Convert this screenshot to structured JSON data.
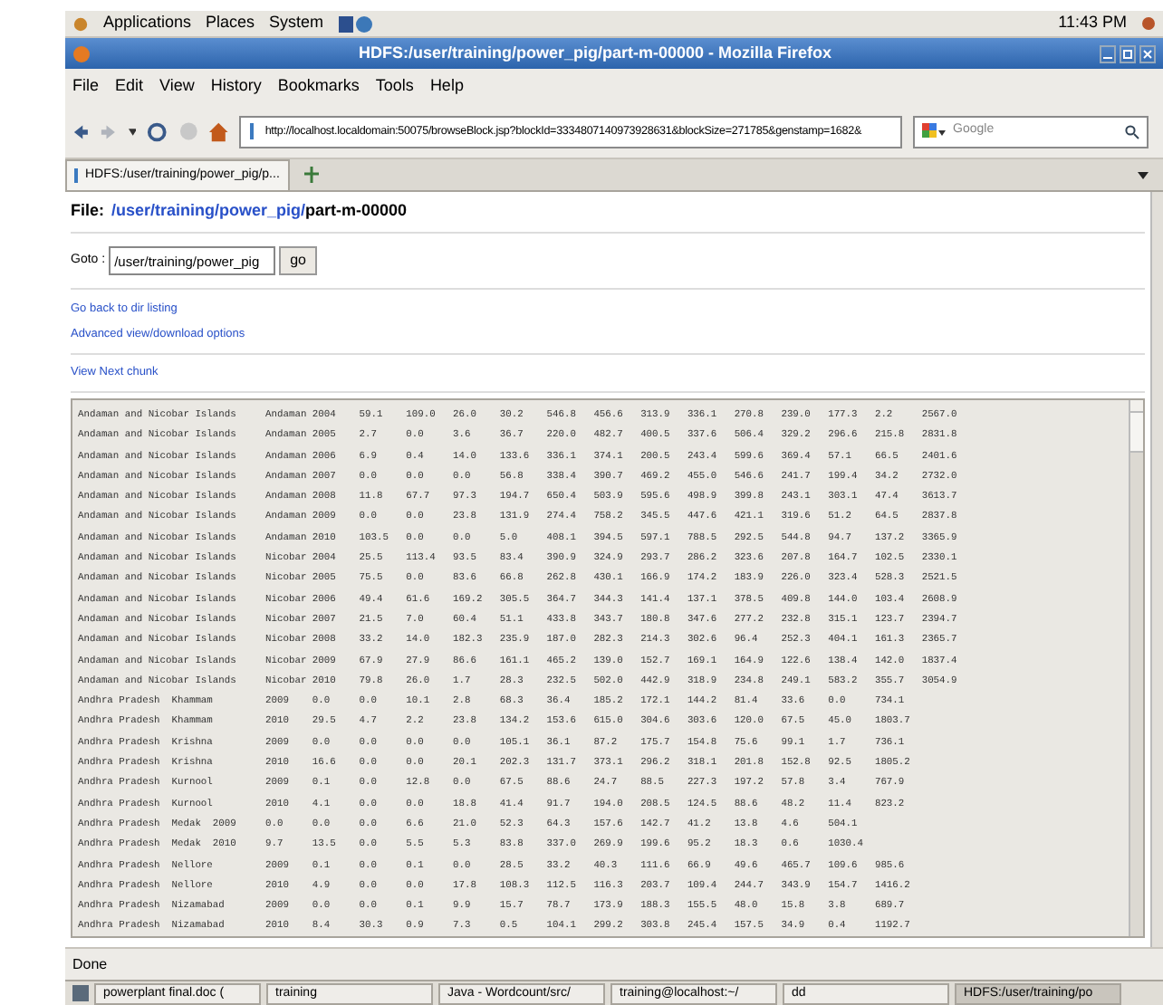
{
  "top_panel": {
    "menus": [
      "Applications",
      "Places",
      "System"
    ],
    "clock": "11:43 PM"
  },
  "window": {
    "title": "HDFS:/user/training/power_pig/part-m-00000 - Mozilla Firefox"
  },
  "menu": [
    "File",
    "Edit",
    "View",
    "History",
    "Bookmarks",
    "Tools",
    "Help"
  ],
  "nav": {
    "url": "http://localhost.localdomain:50075/browseBlock.jsp?blockId=3334807140973928631&blockSize=271785&genstamp=1682&",
    "search_placeholder": "Google"
  },
  "tabs": [
    {
      "label": "HDFS:/user/training/power_pig/p...",
      "selected": true
    }
  ],
  "page": {
    "file_label": "File:",
    "path_link": "/user/training/power_pig/",
    "file_name": "part-m-00000",
    "goto_label": "Goto :",
    "goto_value": "/user/training/power_pig",
    "go_button": "go",
    "links": [
      "Go back to dir listing",
      "Advanced view/download options"
    ],
    "next_link": "View Next chunk",
    "lines": [
      "Andaman and Nicobar Islands\tAndaman 2004\t59.1\t109.0\t26.0\t30.2\t546.8\t456.6\t313.9\t336.1\t270.8\t239.0\t177.3\t2.2\t2567.0",
      "Andaman and Nicobar Islands\tAndaman 2005\t2.7\t0.0\t3.6\t36.7\t220.0\t482.7\t400.5\t337.6\t506.4\t329.2\t296.6\t215.8\t2831.8",
      "Andaman and Nicobar Islands\tAndaman 2006\t6.9\t0.4\t14.0\t133.6\t336.1\t374.1\t200.5\t243.4\t599.6\t369.4\t57.1\t66.5\t2401.6",
      "Andaman and Nicobar Islands\tAndaman 2007\t0.0\t0.0\t0.0\t56.8\t338.4\t390.7\t469.2\t455.0\t546.6\t241.7\t199.4\t34.2\t2732.0",
      "Andaman and Nicobar Islands\tAndaman 2008\t11.8\t67.7\t97.3\t194.7\t650.4\t503.9\t595.6\t498.9\t399.8\t243.1\t303.1\t47.4\t3613.7",
      "Andaman and Nicobar Islands\tAndaman 2009\t0.0\t0.0\t23.8\t131.9\t274.4\t758.2\t345.5\t447.6\t421.1\t319.6\t51.2\t64.5\t2837.8",
      "Andaman and Nicobar Islands\tAndaman 2010\t103.5\t0.0\t0.0\t5.0\t408.1\t394.5\t597.1\t788.5\t292.5\t544.8\t94.7\t137.2\t3365.9",
      "Andaman and Nicobar Islands\tNicobar 2004\t25.5\t113.4\t93.5\t83.4\t390.9\t324.9\t293.7\t286.2\t323.6\t207.8\t164.7\t102.5\t2330.1",
      "Andaman and Nicobar Islands\tNicobar 2005\t75.5\t0.0\t83.6\t66.8\t262.8\t430.1\t166.9\t174.2\t183.9\t226.0\t323.4\t528.3\t2521.5",
      "Andaman and Nicobar Islands\tNicobar 2006\t49.4\t61.6\t169.2\t305.5\t364.7\t344.3\t141.4\t137.1\t378.5\t409.8\t144.0\t103.4\t2608.9",
      "Andaman and Nicobar Islands\tNicobar 2007\t21.5\t7.0\t60.4\t51.1\t433.8\t343.7\t180.8\t347.6\t277.2\t232.8\t315.1\t123.7\t2394.7",
      "Andaman and Nicobar Islands\tNicobar 2008\t33.2\t14.0\t182.3\t235.9\t187.0\t282.3\t214.3\t302.6\t96.4\t252.3\t404.1\t161.3\t2365.7",
      "Andaman and Nicobar Islands\tNicobar 2009\t67.9\t27.9\t86.6\t161.1\t465.2\t139.0\t152.7\t169.1\t164.9\t122.6\t138.4\t142.0\t1837.4",
      "Andaman and Nicobar Islands\tNicobar 2010\t79.8\t26.0\t1.7\t28.3\t232.5\t502.0\t442.9\t318.9\t234.8\t249.1\t583.2\t355.7\t3054.9",
      "Andhra Pradesh  Khammam\t\t2009\t0.0\t0.0\t10.1\t2.8\t68.3\t36.4\t185.2\t172.1\t144.2\t81.4\t33.6\t0.0\t734.1",
      "Andhra Pradesh  Khammam\t\t2010\t29.5\t4.7\t2.2\t23.8\t134.2\t153.6\t615.0\t304.6\t303.6\t120.0\t67.5\t45.0\t1803.7",
      "Andhra Pradesh  Krishna\t\t2009\t0.0\t0.0\t0.0\t0.0\t105.1\t36.1\t87.2\t175.7\t154.8\t75.6\t99.1\t1.7\t736.1",
      "Andhra Pradesh  Krishna\t\t2010\t16.6\t0.0\t0.0\t20.1\t202.3\t131.7\t373.1\t296.2\t318.1\t201.8\t152.8\t92.5\t1805.2",
      "Andhra Pradesh  Kurnool\t\t2009\t0.1\t0.0\t12.8\t0.0\t67.5\t88.6\t24.7\t88.5\t227.3\t197.2\t57.8\t3.4\t767.9",
      "Andhra Pradesh  Kurnool\t\t2010\t4.1\t0.0\t0.0\t18.8\t41.4\t91.7\t194.0\t208.5\t124.5\t88.6\t48.2\t11.4\t823.2",
      "Andhra Pradesh  Medak  2009\t0.0\t0.0\t0.0\t6.6\t21.0\t52.3\t64.3\t157.6\t142.7\t41.2\t13.8\t4.6\t504.1",
      "Andhra Pradesh  Medak  2010\t9.7\t13.5\t0.0\t5.5\t5.3\t83.8\t337.0\t269.9\t199.6\t95.2\t18.3\t0.6\t1030.4",
      "Andhra Pradesh  Nellore\t\t2009\t0.1\t0.0\t0.1\t0.0\t28.5\t33.2\t40.3\t111.6\t66.9\t49.6\t465.7\t109.6\t985.6",
      "Andhra Pradesh  Nellore\t\t2010\t4.9\t0.0\t0.0\t17.8\t108.3\t112.5\t116.3\t203.7\t109.4\t244.7\t343.9\t154.7\t1416.2",
      "Andhra Pradesh  Nizamabad\t2009\t0.0\t0.0\t0.1\t9.9\t15.7\t78.7\t173.9\t188.3\t155.5\t48.0\t15.8\t3.8\t689.7",
      "Andhra Pradesh  Nizamabad\t2010\t8.4\t30.3\t0.9\t7.3\t0.5\t104.1\t299.2\t303.8\t245.4\t157.5\t34.9\t0.4\t1192.7"
    ]
  },
  "status": "Done",
  "taskbar": [
    {
      "label": "powerplant final.doc (",
      "selected": false
    },
    {
      "label": "training",
      "selected": false
    },
    {
      "label": "Java - Wordcount/src/",
      "selected": false
    },
    {
      "label": "training@localhost:~/",
      "selected": false
    },
    {
      "label": "dd",
      "selected": false
    },
    {
      "label": "HDFS:/user/training/po",
      "selected": true
    }
  ]
}
